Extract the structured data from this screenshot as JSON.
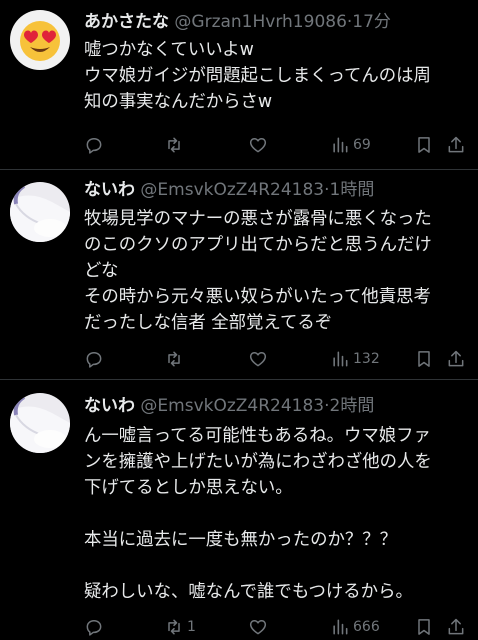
{
  "colors": {
    "background": "#000000",
    "text": "#e7e9ea",
    "secondary": "#71767b",
    "divider": "#2f3336"
  },
  "tweets": [
    {
      "name": "あかさたな",
      "handle": "@Grzan1Hvrh19086",
      "dot": "·",
      "time": "17分",
      "avatar_icon": "heart-eyes-emoji-avatar",
      "lines": [
        "嘘つかなくていいよw",
        "ウマ娘ガイジが問題起こしまくってんのは周",
        "知の事実なんだからさw"
      ],
      "views": "69"
    },
    {
      "name": "ないわ",
      "handle": "@EmsvkOzZ4R24183",
      "dot": "·",
      "time": "1時間",
      "avatar_icon": "white-character-avatar",
      "lines": [
        "牧場見学のマナーの悪さが露骨に悪くなった",
        "のこのクソのアプリ出てからだと思うんだけ",
        "どな",
        "その時から元々悪い奴らがいたって他責思考",
        "だったしな信者 全部覚えてるぞ"
      ],
      "views": "132"
    },
    {
      "name": "ないわ",
      "handle": "@EmsvkOzZ4R24183",
      "dot": "·",
      "time": "2時間",
      "avatar_icon": "white-character-avatar",
      "lines": [
        "ん一嘘言ってる可能性もあるね。ウマ娘ファ",
        "ンを擁護や上げたいが為にわざわざ他の人を",
        "下げてるとしか思えない。",
        "",
        "本当に過去に一度も無かったのか？？？",
        "",
        "疑わしいな、嘘なんで誰でもつけるから。"
      ],
      "retweets": "1",
      "views": "666"
    }
  ]
}
